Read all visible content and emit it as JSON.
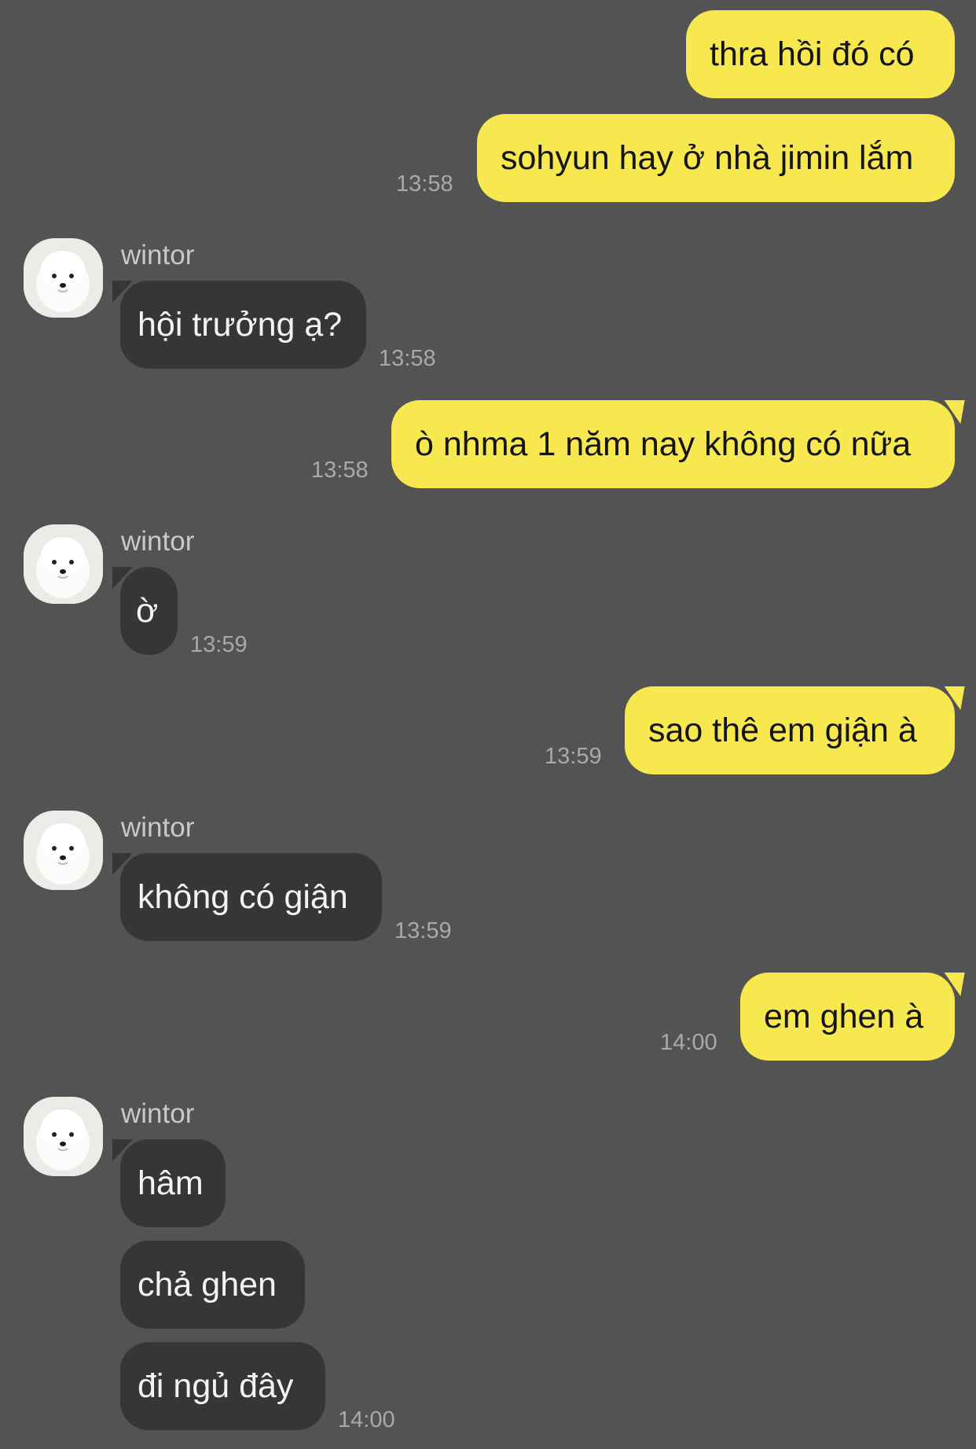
{
  "contact": {
    "name": "wintor"
  },
  "colors": {
    "background": "#545354",
    "outgoing_bubble": "#f8e84f",
    "incoming_bubble": "#363537",
    "timestamp": "#a9a8aa"
  },
  "messages": [
    {
      "direction": "out",
      "text": "thra hồi đó có",
      "time": ""
    },
    {
      "direction": "out",
      "text": "sohyun hay ở nhà jimin lắm",
      "time": "13:58"
    },
    {
      "direction": "in",
      "sender": "wintor",
      "text": "hội trưởng ạ?",
      "time": "13:58"
    },
    {
      "direction": "out",
      "text": "ò nhma 1 năm nay không có nữa",
      "time": "13:58"
    },
    {
      "direction": "in",
      "sender": "wintor",
      "text": "ờ",
      "time": "13:59"
    },
    {
      "direction": "out",
      "text": "sao thê em giận à",
      "time": "13:59"
    },
    {
      "direction": "in",
      "sender": "wintor",
      "text": "không có giận",
      "time": "13:59"
    },
    {
      "direction": "out",
      "text": "em ghen à",
      "time": "14:00"
    },
    {
      "direction": "in",
      "sender": "wintor",
      "text": "hâm",
      "time": ""
    },
    {
      "direction": "in",
      "text": "chả ghen",
      "time": ""
    },
    {
      "direction": "in",
      "text": "đi ngủ đây",
      "time": "14:00"
    }
  ],
  "icons": {
    "avatar": "white-puppy-avatar"
  }
}
